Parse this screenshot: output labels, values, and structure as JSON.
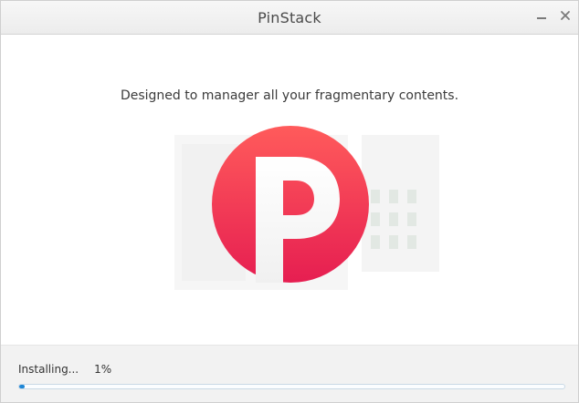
{
  "window": {
    "title": "PinStack"
  },
  "content": {
    "tagline": "Designed to manager all your fragmentary contents.",
    "logo_letter": "P"
  },
  "footer": {
    "status_text": "Installing...",
    "percent_text": "1%",
    "progress_percent": 1
  },
  "colors": {
    "logo_gradient_top": "#ff5b5b",
    "logo_gradient_bottom": "#e61e51",
    "progress_fill": "#1e86d6"
  },
  "icons": {
    "minimize": "minimize-icon",
    "close": "close-icon"
  }
}
